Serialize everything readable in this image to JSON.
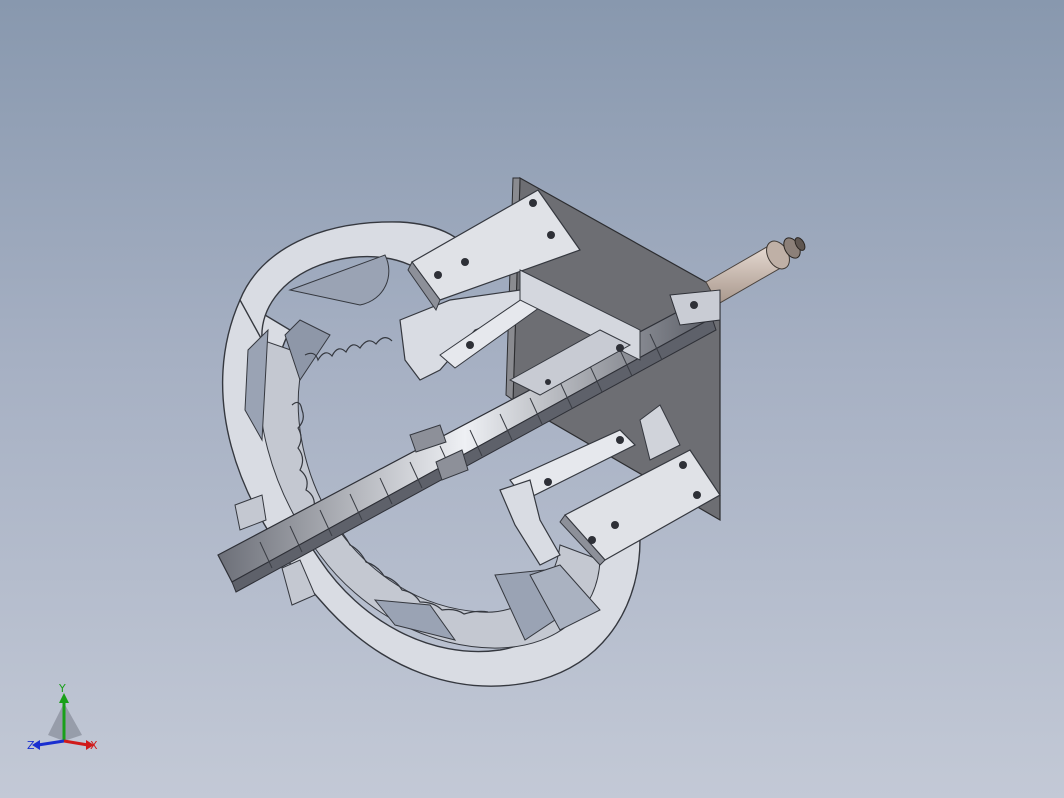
{
  "viewport": {
    "background_top": "#8898ae",
    "background_bottom": "#c3c9d6"
  },
  "model": {
    "part_fill": "#d6d9e0",
    "part_edge": "#3a3d44",
    "plate_fill": "#6d6e73",
    "cylinder_fill": "#c9b8ae"
  },
  "triad": {
    "y_label": "Y",
    "z_label": "Z",
    "x_label": "X",
    "y_color": "#19a019",
    "z_color": "#1a2fd0",
    "x_color": "#d01a1a"
  }
}
